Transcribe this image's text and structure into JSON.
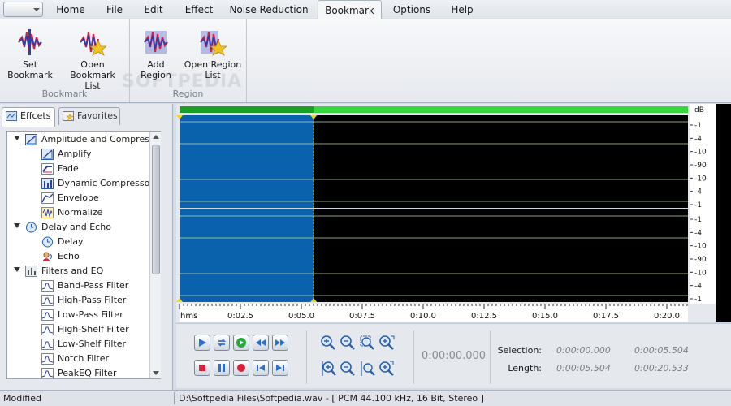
{
  "menu": {
    "tabs": [
      {
        "label": "Home"
      },
      {
        "label": "File"
      },
      {
        "label": "Edit"
      },
      {
        "label": "Effect"
      },
      {
        "label": "Noise Reduction"
      },
      {
        "label": "Bookmark"
      },
      {
        "label": "Options"
      },
      {
        "label": "Help"
      }
    ],
    "active": "Bookmark"
  },
  "ribbon": {
    "watermark": "SOFTPEDIA",
    "groups": [
      {
        "title": "Bookmark",
        "buttons": [
          {
            "line1": "Set",
            "line2": "Bookmark",
            "icon": "set-bookmark-icon"
          },
          {
            "line1": "Open Bookmark",
            "line2": "List",
            "icon": "open-bookmark-list-icon"
          }
        ]
      },
      {
        "title": "Region",
        "buttons": [
          {
            "line1": "Add",
            "line2": "Region",
            "icon": "add-region-icon"
          },
          {
            "line1": "Open Region",
            "line2": "List",
            "icon": "open-region-list-icon"
          }
        ]
      }
    ]
  },
  "panel": {
    "tabs": [
      {
        "label": "Effcets"
      },
      {
        "label": "Favorites"
      }
    ],
    "tree": [
      {
        "label": "Amplitude and Compressi",
        "level": 0,
        "icon": "amplitude-icon"
      },
      {
        "label": "Amplify",
        "level": 1,
        "icon": "amplify-icon"
      },
      {
        "label": "Fade",
        "level": 1,
        "icon": "fade-icon"
      },
      {
        "label": "Dynamic Compressor",
        "level": 1,
        "icon": "compressor-icon"
      },
      {
        "label": "Envelope",
        "level": 1,
        "icon": "envelope-icon"
      },
      {
        "label": "Normalize",
        "level": 1,
        "icon": "normalize-icon"
      },
      {
        "label": "Delay and Echo",
        "level": 0,
        "icon": "delay-echo-icon"
      },
      {
        "label": "Delay",
        "level": 1,
        "icon": "delay-icon"
      },
      {
        "label": "Echo",
        "level": 1,
        "icon": "echo-icon"
      },
      {
        "label": "Filters and EQ",
        "level": 0,
        "icon": "filters-icon"
      },
      {
        "label": "Band-Pass Filter",
        "level": 1,
        "icon": "filter-icon"
      },
      {
        "label": "High-Pass Filter",
        "level": 1,
        "icon": "filter-icon"
      },
      {
        "label": "Low-Pass Filter",
        "level": 1,
        "icon": "filter-icon"
      },
      {
        "label": "High-Shelf Filter",
        "level": 1,
        "icon": "filter-icon"
      },
      {
        "label": "Low-Shelf Filter",
        "level": 1,
        "icon": "filter-icon"
      },
      {
        "label": "Notch Filter",
        "level": 1,
        "icon": "filter-icon"
      },
      {
        "label": "PeakEQ Filter",
        "level": 1,
        "icon": "filter-icon"
      }
    ]
  },
  "waveform": {
    "db_header": "dB",
    "db_labels_channel1": [
      "-1",
      "-4",
      "-10",
      "-90",
      "-10",
      "-4",
      "-1"
    ],
    "db_labels_channel2": [
      "-1",
      "-4",
      "-10",
      "-90",
      "-10",
      "-4",
      "-1"
    ],
    "time_labels": [
      "hms",
      "0:02.5",
      "0:05.0",
      "0:07.5",
      "0:10.0",
      "0:12.5",
      "0:15.0",
      "0:17.5",
      "0:20.0"
    ],
    "total_seconds": 20.533,
    "selection_end_seconds": 5.504,
    "colors": {
      "background": "#000000",
      "selection": "#0a62ad",
      "overview": "#36d63f",
      "gridline": "#b9d9a4"
    }
  },
  "transport": {
    "time": "0:00:00.000",
    "selection_label": "Selection:",
    "length_label": "Length:",
    "selection_start": "0:00:00.000",
    "selection_end": "0:00:05.504",
    "length_selection": "0:00:05.504",
    "length_total": "0:00:20.533"
  },
  "status": {
    "left": "Modified",
    "right": "D:\\Softpedia Files\\Softpedia.wav - [ PCM 44.100 kHz, 16 Bit, Stereo ]"
  }
}
